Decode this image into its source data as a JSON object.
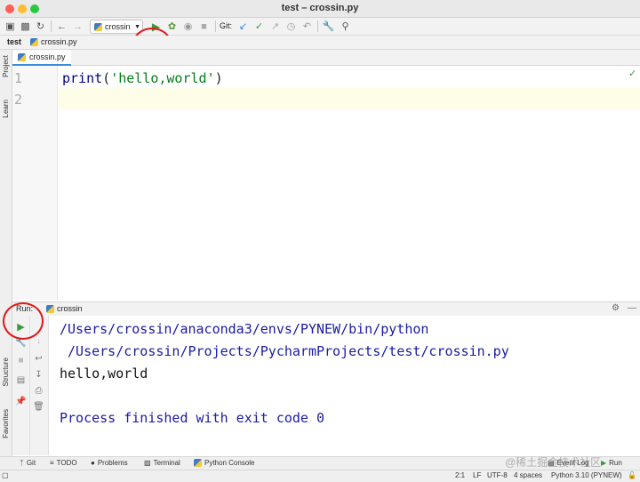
{
  "window": {
    "title": "test – crossin.py"
  },
  "toolbar": {
    "run_config": "crossin",
    "git_label": "Git:"
  },
  "navbar": {
    "project": "test",
    "file": "crossin.py"
  },
  "left_strip": {
    "project": "Project",
    "learn": "Learn",
    "structure": "Structure",
    "favorites": "Favorites"
  },
  "editor": {
    "tab": "crossin.py",
    "line_numbers": [
      "1",
      "2"
    ],
    "code": {
      "func": "print",
      "open": "(",
      "string": "'hello,world'",
      "close": ")"
    }
  },
  "run_panel": {
    "label": "Run:",
    "config": "crossin",
    "output": [
      "/Users/crossin/anaconda3/envs/PYNEW/bin/python",
      " /Users/crossin/Projects/PycharmProjects/test/crossin.py",
      "hello,world",
      "",
      "Process finished with exit code 0"
    ]
  },
  "bottom_tabs": [
    "Git",
    "TODO",
    "Problems",
    "Terminal",
    "Python Console"
  ],
  "bottom_right": {
    "event_log": "Event Log",
    "run": "Run"
  },
  "status": {
    "position": "2:1",
    "line_sep": "LF",
    "encoding": "UTF-8",
    "indent": "4 spaces",
    "interpreter": "Python 3.10 (PYNEW)"
  },
  "watermark": "@稀土掘金技术社区",
  "colors": {
    "path_blue": "#1a1aa6",
    "string_green": "#067d17",
    "func_blue": "#000080",
    "run_green": "#3a9a3a",
    "annotation_red": "#e01a1a"
  }
}
